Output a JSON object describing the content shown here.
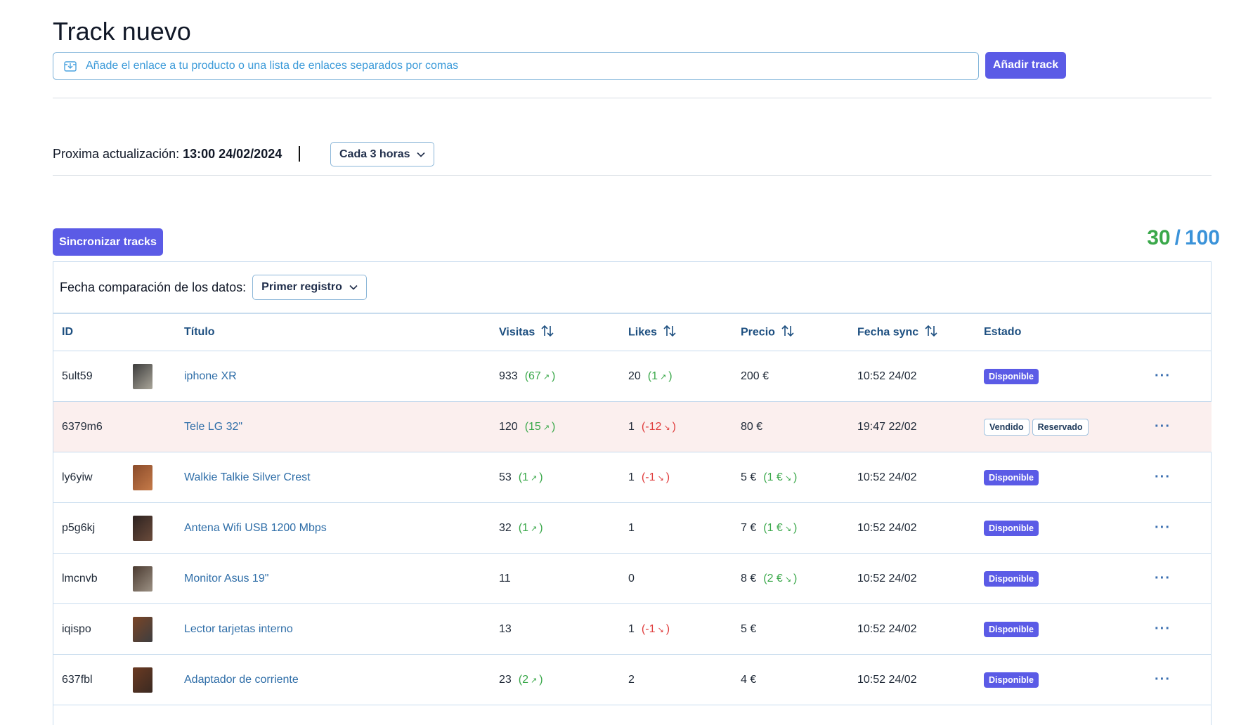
{
  "header": {
    "title": "Track nuevo",
    "url_placeholder": "Añade el enlace a tu producto o una lista de enlaces separados por comas",
    "add_button": "Añadir track"
  },
  "update": {
    "label": "Proxima actualización:",
    "value": "13:00 24/02/2024",
    "frequency": "Cada 3 horas"
  },
  "sync_button": "Sincronizar tracks",
  "counter": {
    "used": "30",
    "separator": "/",
    "total": "100"
  },
  "compare": {
    "label": "Fecha comparación de los datos:",
    "value": "Primer registro"
  },
  "table": {
    "headers": {
      "id": "ID",
      "title": "Título",
      "visits": "Visitas",
      "likes": "Likes",
      "price": "Precio",
      "sync": "Fecha sync",
      "status": "Estado"
    },
    "rows": [
      {
        "id": "5ult59",
        "has_thumb": true,
        "thumb": [
          "#3b3b3b",
          "#aaa69a"
        ],
        "title": "iphone XR",
        "visits": "933",
        "visits_delta": "67",
        "visits_dir": "up",
        "likes": "20",
        "likes_delta": "1",
        "likes_dir": "up",
        "price": "200 €",
        "price_delta": "",
        "price_dir": "",
        "sync": "10:52 24/02",
        "status": [
          "Disponible"
        ],
        "sold": false
      },
      {
        "id": "6379m6",
        "has_thumb": false,
        "thumb": [
          "#ffffff",
          "#ffffff"
        ],
        "title": "Tele LG 32\"",
        "visits": "120",
        "visits_delta": "15",
        "visits_dir": "up",
        "likes": "1",
        "likes_delta": "-12",
        "likes_dir": "down",
        "price": "80 €",
        "price_delta": "",
        "price_dir": "",
        "sync": "19:47 22/02",
        "status": [
          "Vendido",
          "Reservado"
        ],
        "sold": true
      },
      {
        "id": "ly6yiw",
        "has_thumb": true,
        "thumb": [
          "#8a4b2a",
          "#c57a49"
        ],
        "title": "Walkie Talkie Silver Crest",
        "visits": "53",
        "visits_delta": "1",
        "visits_dir": "up",
        "likes": "1",
        "likes_delta": "-1",
        "likes_dir": "down",
        "price": "5 €",
        "price_delta": "1 €",
        "price_dir": "up-down",
        "sync": "10:52 24/02",
        "status": [
          "Disponible"
        ],
        "sold": false
      },
      {
        "id": "p5g6kj",
        "has_thumb": true,
        "thumb": [
          "#2c2220",
          "#6b4b3b"
        ],
        "title": "Antena Wifi USB 1200 Mbps",
        "visits": "32",
        "visits_delta": "1",
        "visits_dir": "up",
        "likes": "1",
        "likes_delta": "",
        "likes_dir": "",
        "price": "7 €",
        "price_delta": "1 €",
        "price_dir": "up-down",
        "sync": "10:52 24/02",
        "status": [
          "Disponible"
        ],
        "sold": false
      },
      {
        "id": "lmcnvb",
        "has_thumb": true,
        "thumb": [
          "#4a3a30",
          "#9c9184"
        ],
        "title": "Monitor Asus 19\"",
        "visits": "11",
        "visits_delta": "",
        "visits_dir": "",
        "likes": "0",
        "likes_delta": "",
        "likes_dir": "",
        "price": "8 €",
        "price_delta": "2 €",
        "price_dir": "up-down",
        "sync": "10:52 24/02",
        "status": [
          "Disponible"
        ],
        "sold": false
      },
      {
        "id": "iqispo",
        "has_thumb": true,
        "thumb": [
          "#7a4526",
          "#3e3e40"
        ],
        "title": "Lector tarjetas interno",
        "visits": "13",
        "visits_delta": "",
        "visits_dir": "",
        "likes": "1",
        "likes_delta": "-1",
        "likes_dir": "down",
        "price": "5 €",
        "price_delta": "",
        "price_dir": "",
        "sync": "10:52 24/02",
        "status": [
          "Disponible"
        ],
        "sold": false
      },
      {
        "id": "637fbl",
        "has_thumb": true,
        "thumb": [
          "#6b3a22",
          "#3a2a22"
        ],
        "title": "Adaptador de corriente",
        "visits": "23",
        "visits_delta": "2",
        "visits_dir": "up",
        "likes": "2",
        "likes_delta": "",
        "likes_dir": "",
        "price": "4 €",
        "price_delta": "",
        "price_dir": "",
        "sync": "10:52 24/02",
        "status": [
          "Disponible"
        ],
        "sold": false
      }
    ]
  },
  "icons": {
    "upload": "download-box-icon",
    "chevron": "chevron-down-icon",
    "sort": "sort-arrows-icon",
    "menu": "more-horizontal-icon",
    "trend_up": "trend-up-icon",
    "trend_down": "trend-down-icon"
  },
  "colors": {
    "primary": "#5b5be6",
    "link": "#2f6ea8",
    "up": "#3aa84a",
    "down": "#e03e3e",
    "counter_total": "#3b93d9",
    "sold_row": "#fbefee"
  }
}
